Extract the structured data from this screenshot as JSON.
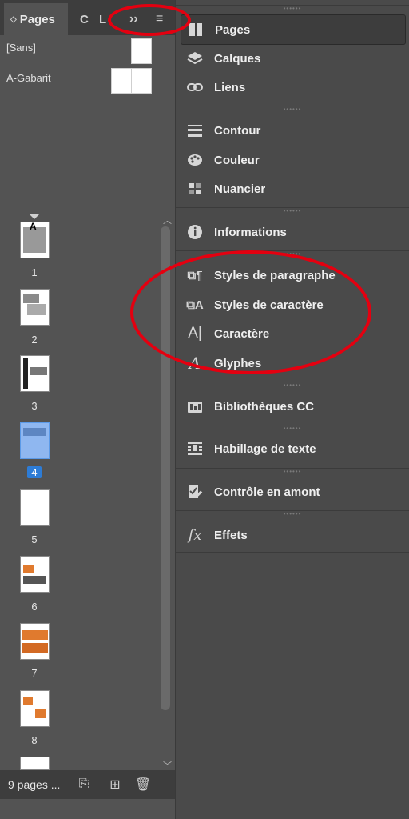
{
  "left_panel": {
    "tabs": [
      {
        "label": "Pages"
      },
      {
        "label": "C"
      },
      {
        "label": "L"
      },
      {
        "label": "››"
      },
      {
        "label": "≡"
      }
    ],
    "masters": [
      {
        "label": "[Sans]"
      },
      {
        "label": "A-Gabarit"
      }
    ],
    "master_marker": "A",
    "pages": [
      {
        "number": "1"
      },
      {
        "number": "2"
      },
      {
        "number": "3"
      },
      {
        "number": "4",
        "selected": true
      },
      {
        "number": "5"
      },
      {
        "number": "6"
      },
      {
        "number": "7"
      },
      {
        "number": "8"
      }
    ],
    "footer": {
      "count_label": "9 pages ..."
    }
  },
  "right_panel": {
    "items": [
      {
        "label": "Pages",
        "icon": "pages-icon"
      },
      {
        "label": "Calques",
        "icon": "layers-icon"
      },
      {
        "label": "Liens",
        "icon": "links-icon"
      },
      {
        "label": "Contour",
        "icon": "stroke-icon"
      },
      {
        "label": "Couleur",
        "icon": "color-icon"
      },
      {
        "label": "Nuancier",
        "icon": "swatches-icon"
      },
      {
        "label": "Informations",
        "icon": "info-icon"
      },
      {
        "label": "Styles de paragraphe",
        "icon": "paragraph-styles-icon"
      },
      {
        "label": "Styles de caractère",
        "icon": "character-styles-icon"
      },
      {
        "label": "Caractère",
        "icon": "character-icon"
      },
      {
        "label": "Glyphes",
        "icon": "glyphs-icon"
      },
      {
        "label": "Bibliothèques CC",
        "icon": "cc-libraries-icon"
      },
      {
        "label": "Habillage de texte",
        "icon": "text-wrap-icon"
      },
      {
        "label": "Contrôle en amont",
        "icon": "preflight-icon"
      },
      {
        "label": "Effets",
        "icon": "effects-icon"
      }
    ]
  },
  "colors": {
    "annotation": "#e40010",
    "selection": "#2d7cd6"
  }
}
